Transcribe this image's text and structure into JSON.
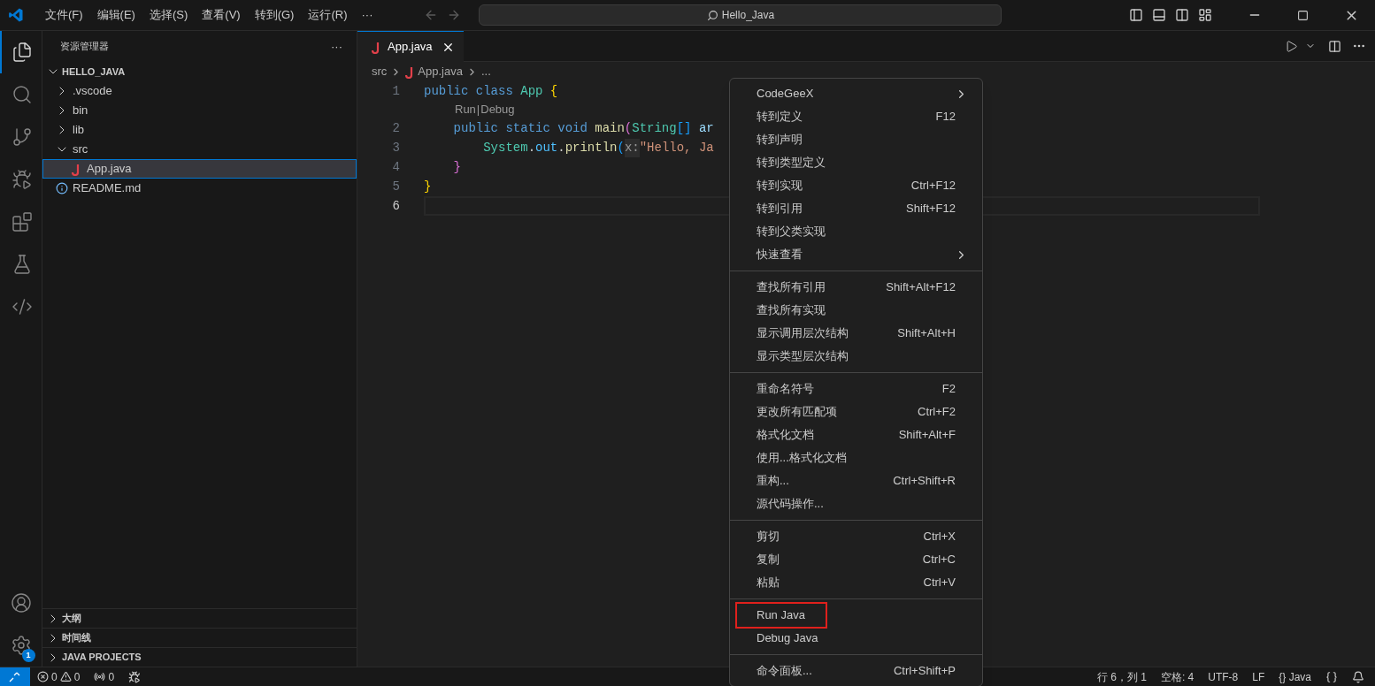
{
  "title_bar": {
    "menus": [
      "文件(F)",
      "编辑(E)",
      "选择(S)",
      "查看(V)",
      "转到(G)",
      "运行(R)",
      "···"
    ],
    "search": {
      "value": "Hello_Java"
    }
  },
  "activity_bar": {
    "items": [
      {
        "kind": "explorer",
        "selected": true
      },
      {
        "kind": "search",
        "selected": false
      },
      {
        "kind": "scm",
        "selected": false
      },
      {
        "kind": "debug",
        "selected": false
      },
      {
        "kind": "extensions",
        "selected": false
      },
      {
        "kind": "testing",
        "selected": false
      },
      {
        "kind": "remote",
        "selected": false
      }
    ],
    "settings_badge": "1"
  },
  "sidebar": {
    "title": "资源管理器",
    "more": "···",
    "root": {
      "label": "HELLO_JAVA",
      "expanded": true,
      "children": [
        {
          "label": ".vscode",
          "kind": "folder",
          "expanded": false,
          "selected": false
        },
        {
          "label": "bin",
          "kind": "folder",
          "expanded": false,
          "selected": false
        },
        {
          "label": "lib",
          "kind": "folder",
          "expanded": false,
          "selected": false
        },
        {
          "label": "src",
          "kind": "folder",
          "expanded": true,
          "selected": false,
          "children": [
            {
              "label": "App.java",
              "kind": "java",
              "selected": true
            }
          ]
        },
        {
          "label": "README.md",
          "kind": "info",
          "selected": false
        }
      ]
    },
    "panels": [
      {
        "label": "大纲",
        "expanded": false
      },
      {
        "label": "时间线",
        "expanded": false
      },
      {
        "label": "JAVA PROJECTS",
        "expanded": false
      }
    ]
  },
  "editor": {
    "tabs": [
      {
        "label": "App.java",
        "selected": true
      }
    ],
    "breadcrumb": [
      "src",
      "App.java",
      "..."
    ],
    "lines": [
      {
        "number": "1",
        "tokens": [
          {
            "t": "public ",
            "kind": "kw"
          },
          {
            "t": "class ",
            "kind": "kw"
          },
          {
            "t": "App ",
            "kind": "type"
          },
          {
            "t": "{",
            "kind": "b1"
          }
        ]
      },
      {
        "kind": "lens",
        "items": [
          "Run",
          "Debug"
        ],
        "separator": "|"
      },
      {
        "number": "2",
        "tokens": [
          {
            "t": "    public ",
            "kind": "kw"
          },
          {
            "t": "static ",
            "kind": "kw"
          },
          {
            "t": "void ",
            "kind": "kw"
          },
          {
            "t": "main",
            "kind": "fn"
          },
          {
            "t": "(",
            "kind": "b2"
          },
          {
            "t": "String",
            "kind": "type"
          },
          {
            "t": "[] ",
            "kind": "b3"
          },
          {
            "t": "ar",
            "kind": "var"
          }
        ]
      },
      {
        "number": "3",
        "tokens": [
          {
            "t": "        System",
            "kind": "type"
          },
          {
            "t": ".",
            "kind": "plain"
          },
          {
            "t": "out",
            "kind": "const"
          },
          {
            "t": ".",
            "kind": "plain"
          },
          {
            "t": "println",
            "kind": "fn"
          },
          {
            "t": "(",
            "kind": "b3"
          },
          {
            "t": "x:",
            "kind": "hint"
          },
          {
            "t": "\"Hello, Ja",
            "kind": "str"
          }
        ]
      },
      {
        "number": "4",
        "tokens": [
          {
            "t": "    }",
            "kind": "b2"
          }
        ]
      },
      {
        "number": "5",
        "tokens": [
          {
            "t": "}",
            "kind": "b1"
          }
        ]
      },
      {
        "number": "6",
        "current": true
      }
    ]
  },
  "context_menu": {
    "groups": [
      [
        {
          "label": "CodeGeeX",
          "submenu": true
        },
        {
          "label": "转到定义",
          "shortcut": "F12"
        },
        {
          "label": "转到声明"
        },
        {
          "label": "转到类型定义"
        },
        {
          "label": "转到实现",
          "shortcut": "Ctrl+F12"
        },
        {
          "label": "转到引用",
          "shortcut": "Shift+F12"
        },
        {
          "label": "转到父类实现"
        },
        {
          "label": "快速查看",
          "submenu": true
        }
      ],
      [
        {
          "label": "查找所有引用",
          "shortcut": "Shift+Alt+F12"
        },
        {
          "label": "查找所有实现"
        },
        {
          "label": "显示调用层次结构",
          "shortcut": "Shift+Alt+H"
        },
        {
          "label": "显示类型层次结构"
        }
      ],
      [
        {
          "label": "重命名符号",
          "shortcut": "F2"
        },
        {
          "label": "更改所有匹配项",
          "shortcut": "Ctrl+F2"
        },
        {
          "label": "格式化文档",
          "shortcut": "Shift+Alt+F"
        },
        {
          "label": "使用...格式化文档"
        },
        {
          "label": "重构...",
          "shortcut": "Ctrl+Shift+R"
        },
        {
          "label": "源代码操作..."
        }
      ],
      [
        {
          "label": "剪切",
          "shortcut": "Ctrl+X"
        },
        {
          "label": "复制",
          "shortcut": "Ctrl+C"
        },
        {
          "label": "粘贴",
          "shortcut": "Ctrl+V"
        }
      ],
      [
        {
          "label": "Run Java",
          "outlined": true
        },
        {
          "label": "Debug Java"
        }
      ],
      [
        {
          "label": "命令面板...",
          "shortcut": "Ctrl+Shift+P"
        }
      ]
    ]
  },
  "status_bar": {
    "errors": "0",
    "warnings": "0",
    "ports": "0",
    "right": [
      "行 6，列 1",
      "空格: 4",
      "UTF-8",
      "LF",
      "{} Java"
    ]
  }
}
